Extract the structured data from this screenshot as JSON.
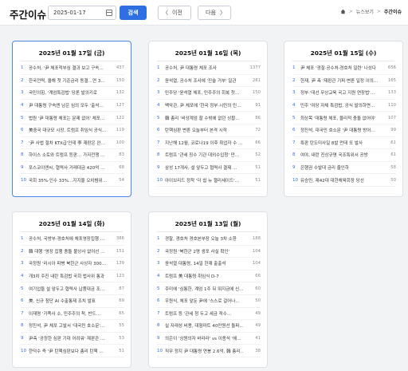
{
  "header": {
    "title": "주간이슈",
    "date_value": "2025-01-17",
    "search_label": "검색",
    "prev_arrow": "〈",
    "prev_label": "이전",
    "next_label": "다음",
    "next_arrow": "〉",
    "accent_color": "#2f6fe4"
  },
  "breadcrumb": {
    "home_icon": "home-icon",
    "sep": ">",
    "section": "뉴스보기",
    "current": "주간이슈"
  },
  "cards": [
    {
      "title": "2025년 01월 17일 (금)",
      "selected": true,
      "items": [
        {
          "num": "1",
          "text": "공수처, '尹 체포적부심 결과 보고 구속…",
          "count": "437"
        },
        {
          "num": "2",
          "text": "한국전력, 올해 첫 기준금리 동결…연 3…",
          "count": "150"
        },
        {
          "num": "3",
          "text": "국민의힘, '계엄특검법' 당론 발의키로 ",
          "count": "132"
        },
        {
          "num": "4",
          "text": "尹 대통령 구속엔 남은 심의 모두 '출석…",
          "count": "127"
        },
        {
          "num": "5",
          "text": "법원 '尹 대통령 체포는 문제 없어' 체포…",
          "count": "122"
        },
        {
          "num": "6",
          "text": "美중국 대규모 시장, 트럼프 취임식 공식…",
          "count": "119"
        },
        {
          "num": "7",
          "text": "'尹 사법 절차 KTX급'인데 李 재판은 완…",
          "count": "100"
        },
        {
          "num": "8",
          "text": "하이스 소토와 트럼프 등판… 가자전쟁 …",
          "count": "83"
        },
        {
          "num": "9",
          "text": "포스코이앤씨, 협력사 거래대금 420억 …",
          "count": "68"
        },
        {
          "num": "10",
          "text": "국회 35%·인수 33%…지지율 오차범위…",
          "count": "54"
        }
      ]
    },
    {
      "title": "2025년 01월 16일 (목)",
      "selected": false,
      "items": [
        {
          "num": "1",
          "text": "공수처, 尹 대통령 체포 조사",
          "count": "1377"
        },
        {
          "num": "2",
          "text": "윤석열, 공수처 조사에 '진술 거부' 일관",
          "count": "281"
        },
        {
          "num": "3",
          "text": "민주당 '윤석열 체포, 민주주의 회복 첫…",
          "count": "150"
        },
        {
          "num": "4",
          "text": "백악관, 尹 체포에 '한국 정부·시민의 민…",
          "count": "91"
        },
        {
          "num": "5",
          "text": "韓 총리 '비상계엄 할 수밖에 없던 상황…",
          "count": "86"
        },
        {
          "num": "6",
          "text": "탄핵심판 변론 오늘부터 본격 시작",
          "count": "72"
        },
        {
          "num": "7",
          "text": "지난해 12월, 코로나19 이후 취업자 수 …",
          "count": "66"
        },
        {
          "num": "8",
          "text": "트럼프 '관세 징수 기관 대외수입청' 만…",
          "count": "52"
        },
        {
          "num": "9",
          "text": "삼성 17개사, 설 앞두고 협력사 결제 …",
          "count": "51"
        },
        {
          "num": "10",
          "text": "아이브리드 정착 '더 쉽 뉴 챌리세이드'…",
          "count": "51"
        }
      ]
    },
    {
      "title": "2025년 01월 15일 (수)",
      "selected": false,
      "items": [
        {
          "num": "1",
          "text": "尹 체포 '경찰·공수처·경호처 일련' 나섰다",
          "count": "656"
        },
        {
          "num": "2",
          "text": "한재, 尹 측 '재판관 기피·변론 일정 이의…",
          "count": "165"
        },
        {
          "num": "3",
          "text": "정부·'대선 무상교육 국고 지원 연장법'…",
          "count": "133"
        },
        {
          "num": "4",
          "text": "민주 '여당 자체 특검법, 공식 발의하면…",
          "count": "110"
        },
        {
          "num": "5",
          "text": "최상목 '대통령 체포, 물리적 충돌 없어야'",
          "count": "107"
        },
        {
          "num": "6",
          "text": "정진석, 대국민 호소문 '尹 대통령 방어…",
          "count": "99"
        },
        {
          "num": "7",
          "text": "특판 탄도미사일 8발 먼데 또 발사",
          "count": "61"
        },
        {
          "num": "8",
          "text": "여야, 내란 진상규명 국조특위서 공방",
          "count": "61"
        },
        {
          "num": "9",
          "text": "은행권 수발대 금리 줄인하",
          "count": "58"
        },
        {
          "num": "10",
          "text": "유승민, 제42대 대한체육회장 당선",
          "count": "50"
        }
      ]
    },
    {
      "title": "2025년 01월 14일 (화)",
      "selected": false,
      "items": [
        {
          "num": "1",
          "text": "공수처, 국방부·경호처에 체포영장집행 …",
          "count": "386"
        },
        {
          "num": "2",
          "text": "韓 대행 '영장 집행 충돌 불상사 없어선 …",
          "count": "151"
        },
        {
          "num": "3",
          "text": "국정원 '러시아 파병 북한군 사상자 300…",
          "count": "139"
        },
        {
          "num": "4",
          "text": "개3차 주진 내란 특검법 국회 법사위 통과",
          "count": "123"
        },
        {
          "num": "5",
          "text": "여기업들 설 앞두고 협력사 납품대금 조…",
          "count": "87"
        },
        {
          "num": "6",
          "text": "美, 신규 첨단 AI 수출통제 조치 발표",
          "count": "69"
        },
        {
          "num": "7",
          "text": "이재명 '가족사 소, 민주주의 척, 반드…",
          "count": "65"
        },
        {
          "num": "8",
          "text": "정진석, 尹 체포 고발서 '대국민 호소문'…",
          "count": "55"
        },
        {
          "num": "9",
          "text": "尹측 '공정한 심판 기대 어려워' 재판관 …",
          "count": "53"
        },
        {
          "num": "10",
          "text": "한덕수 즉 '尹 탄핵심판보다 총리 탄핵 …",
          "count": "51"
        }
      ]
    },
    {
      "title": "2025년 01월 13일 (월)",
      "selected": false,
      "items": [
        {
          "num": "1",
          "text": "경찰, 경호처 경호본부장 오늘 3차 소환",
          "count": "188"
        },
        {
          "num": "2",
          "text": "국정원 '북한군 2명 생포 사실 확인'",
          "count": "104"
        },
        {
          "num": "3",
          "text": "윤석열 대통령, 14일 헌재 출출석",
          "count": "104"
        },
        {
          "num": "4",
          "text": "트럼프 美 대통령 취임식 D-7",
          "count": "66"
        },
        {
          "num": "5",
          "text": "주미에 '심통한, 계엄 1주 뒤 뛰지금에 신…",
          "count": "60"
        },
        {
          "num": "6",
          "text": "우원식, 체포 앞둔 尹에 '스스로 걸어나…",
          "count": "50"
        },
        {
          "num": "7",
          "text": "트럼프 등 '관세 청 두고 세금 적수…",
          "count": "49"
        },
        {
          "num": "8",
          "text": "실 자래성 비용, 대형마트 40만원선 돌파…",
          "count": "49"
        },
        {
          "num": "9",
          "text": "의은이 '상원의자 바라라' vs 이종석 '헤…",
          "count": "41"
        },
        {
          "num": "10",
          "text": "직무 정지 尹 대통령 연봉 2.6억, 韓 총리…",
          "count": "38"
        }
      ]
    }
  ]
}
